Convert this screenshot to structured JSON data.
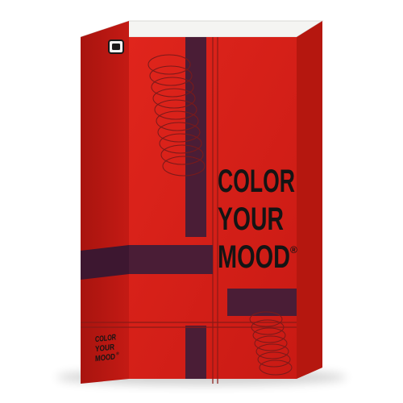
{
  "product": {
    "title_lines": [
      "COLOR",
      "YOUR",
      "MOOD"
    ],
    "registered_mark": "®",
    "spine_lines": [
      "COLOR",
      "YOUR",
      "MOOD"
    ],
    "spine_mark": "®"
  },
  "colors": {
    "box_front": "#d61e18",
    "box_spine": "#bd1812",
    "box_top": "#f4f4f2",
    "stripe": "#4a1d36",
    "line_art": "#7a1a1a",
    "text": "#141414",
    "background": "#ffffff"
  },
  "icons": [
    "cut-corner-notch-icon",
    "spiral-coil-icon"
  ]
}
